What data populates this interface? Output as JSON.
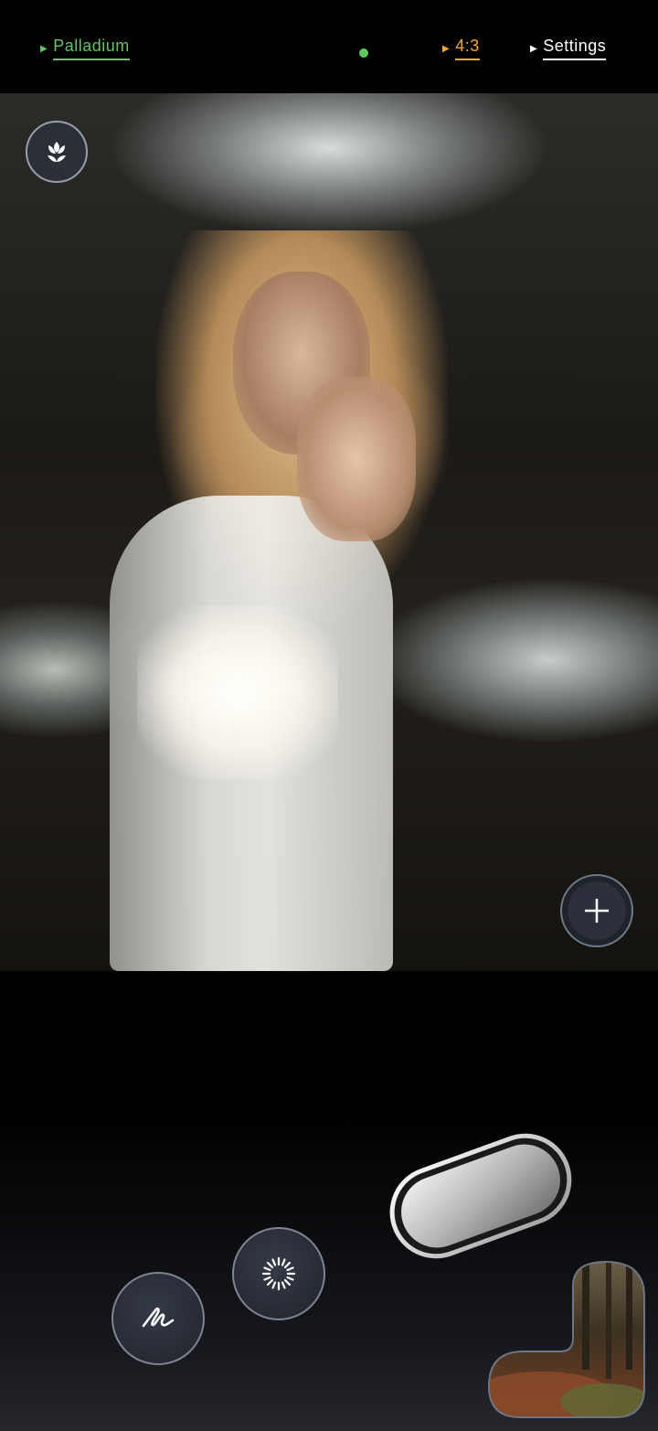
{
  "topbar": {
    "camera_label": "Palladium",
    "ratio_label": "4:3",
    "settings_label": "Settings"
  },
  "colors": {
    "camera_accent": "#6BC06B",
    "ratio_accent": "#F0A830",
    "status_dot": "#5EC95E"
  },
  "icons": {
    "macro": "flower-icon",
    "zoom": "plus-icon",
    "draw": "scribble-icon",
    "timer": "spinner-icon",
    "shutter": "shutter-button",
    "gallery": "gallery-thumbnail"
  }
}
